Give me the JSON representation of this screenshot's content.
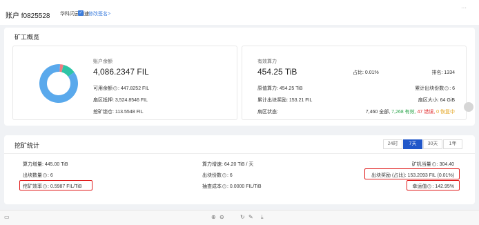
{
  "header": {
    "title": "账户 f0825528",
    "tag": "华科闪云加速",
    "badge": "✓",
    "edit_link": "修改签名>",
    "more": "···"
  },
  "overview": {
    "title": "矿工概览",
    "balance": {
      "label": "账户余额",
      "value": "4,086.2347 FIL",
      "available_label": "可用余额",
      "available_value": ": 447.8252 FIL",
      "sector_pledge_label": "扇区抵押",
      "sector_pledge_value": ": 3,524.8546 FIL",
      "locked_label": "挖矿锁仓",
      "locked_value": ": 113.5548 FIL"
    },
    "power": {
      "label": "有效算力",
      "value": "454.25 TiB",
      "share": "占比: 0.01%",
      "rank": "排名: 1334",
      "raw_label": "原值算力",
      "raw_value": ": 454.25 TiB",
      "total_blocks_label": "累计出块份数",
      "total_blocks_value": ": 6",
      "total_reward_label": "累计出块奖励",
      "total_reward_value": ": 153.21 FIL",
      "sector_size_label": "扇区大小",
      "sector_size_value": ": 64 GiB",
      "sector_status_label": "扇区状态:",
      "sector_all": "7,460 全部,",
      "sector_valid": "7,268 有效,",
      "sector_error": "47 错误,",
      "sector_recover": "0 恢复中"
    },
    "donut": [
      {
        "name": "available",
        "value": 447.8252,
        "color": "#2ec4a6"
      },
      {
        "name": "pledge",
        "value": 3524.8546,
        "color": "#5aa9ec"
      },
      {
        "name": "locked",
        "value": 113.5548,
        "color": "#ef7a82"
      }
    ]
  },
  "mining": {
    "title": "挖矿统计",
    "tabs": [
      "24时",
      "7天",
      "30天",
      "1年"
    ],
    "active_tab": 1,
    "power_increase_label": "算力增量",
    "power_increase_value": ": 445.00 TiB",
    "power_rate_label": "算力增速",
    "power_rate_value": ": 64.20 TiB / 天",
    "machine_equiv_label": "矿机当量",
    "machine_equiv_value": ": 304.40",
    "blocks_label": "出块数量",
    "blocks_value": ": 6",
    "block_shares_label": "出块份数",
    "block_shares_value": ": 6",
    "block_reward_label": "出块奖励 (占比)",
    "block_reward_value": ": 153.2093 FIL (0.01%)",
    "efficiency_label": "挖矿效率",
    "efficiency_value": ": 0.5987 FIL/TiB",
    "sampling_cost_label": "抽查成本",
    "sampling_cost_value": ": 0.0000 FIL/TiB",
    "luck_label": "幸运值",
    "luck_value": ": 142.95%"
  },
  "toolbar": {
    "icons": [
      "save-icon",
      "zoom-in-icon",
      "zoom-out-icon",
      "rotate-icon",
      "edit-icon",
      "download-icon"
    ],
    "glyphs": [
      "▭",
      "⊕",
      "⊖",
      "↻",
      "✎",
      "⤓"
    ]
  }
}
